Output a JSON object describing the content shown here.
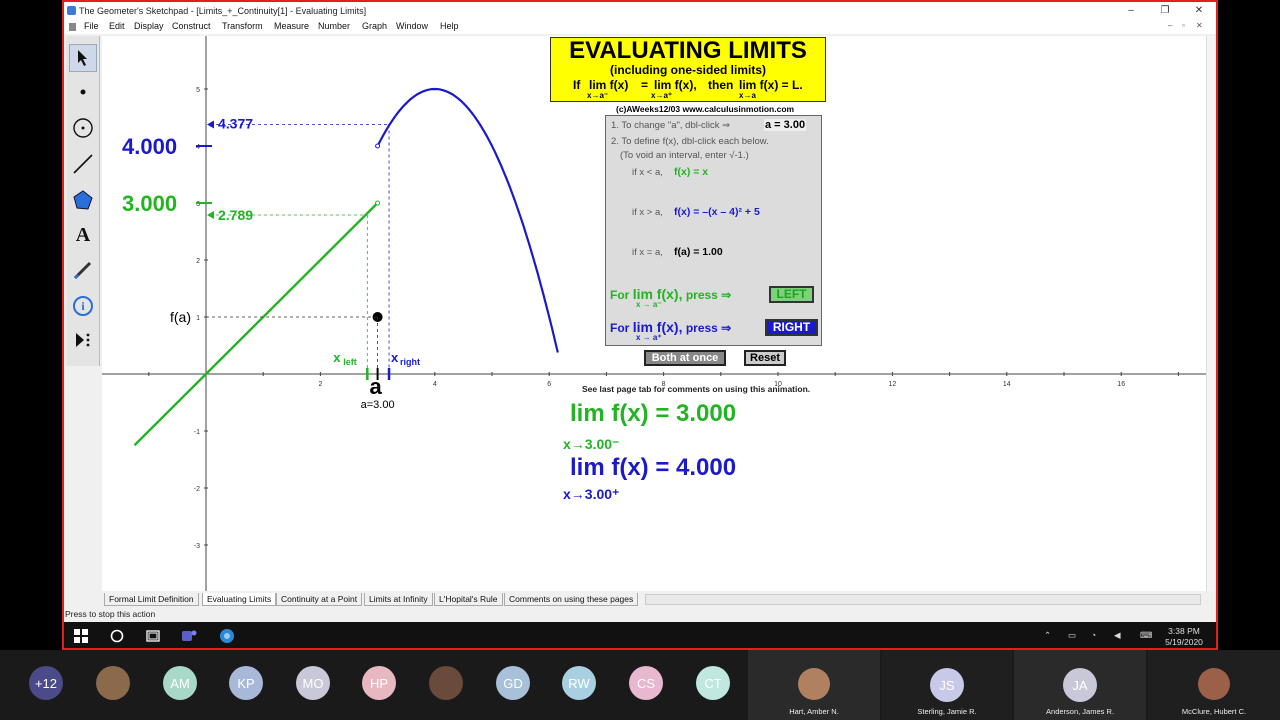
{
  "window": {
    "title": "The Geometer's Sketchpad - [Limits_+_Continuity[1] - Evaluating Limits]",
    "minimize": "–",
    "restore": "❐",
    "close": "✕"
  },
  "menu": [
    "File",
    "Edit",
    "Display",
    "Construct",
    "Transform",
    "Measure",
    "Number",
    "Graph",
    "Window",
    "Help"
  ],
  "tools": [
    "arrow-tool",
    "point-tool",
    "compass-tool",
    "line-tool",
    "polygon-tool",
    "text-tool",
    "marker-tool",
    "information-tool",
    "custom-tool"
  ],
  "text_tool_glyph": "A",
  "info_tool_glyph": "i",
  "banner": {
    "title": "EVALUATING LIMITS",
    "subtitle": "(including one-sided limits)",
    "rule_if": "If",
    "rule_lim1": "lim f(x)",
    "rule_eq1": "=",
    "rule_lim2": "lim f(x),",
    "rule_then": "then",
    "rule_lim3": "lim f(x) = L.",
    "sub1": "x→a⁻",
    "sub2": "x→a⁺",
    "sub3": "x→a",
    "credit": "(c)AWeeks12/03   www.calculusinmotion.com"
  },
  "panel": {
    "step1": "1. To change \"a\", dbl-click ⇒",
    "a_value": "a = 3.00",
    "step2": "2. To define f(x), dbl-click each below.",
    "step2b": "(To void an interval, enter √-1.)",
    "cond_less": "if x < a,",
    "f_less": "f(x) = x",
    "cond_greater": "if x > a,",
    "f_greater": "f(x) = –(x – 4)² + 5",
    "cond_equal": "if x = a,",
    "f_equal": "f(a) = 1.00",
    "for": "For",
    "lim": "lim f(x),",
    "press": "press ⇒",
    "sub_left": "x → a⁻",
    "sub_right": "x → a⁺",
    "left_button": "LEFT",
    "right_button": "RIGHT"
  },
  "buttons": {
    "both": "Both at once",
    "reset": "Reset"
  },
  "note": "See last page tab for comments on using this animation.",
  "results": {
    "left_lim": "lim  f(x) = 3.000",
    "left_sub": "x→3.00⁻",
    "right_lim": "lim  f(x) = 4.000",
    "right_sub": "x→3.00⁺"
  },
  "graph": {
    "x_ticks": [
      "2",
      "4",
      "6",
      "8",
      "10",
      "12",
      "14",
      "16"
    ],
    "y_ticks": [
      "5",
      "4",
      "3",
      "2",
      "1",
      "-1",
      "-2",
      "-3"
    ],
    "label_4000": "4.000",
    "label_3000": "3.000",
    "label_4377": "4.377",
    "label_2789": "2.789",
    "label_fa": "f(a)",
    "label_xleft": "x",
    "label_xleft_sub": "left",
    "label_xright": "x",
    "label_xright_sub": "right",
    "label_a": "a",
    "label_a_value": "a=3.00",
    "colors": {
      "green": "#22b422",
      "blue": "#1a1acc"
    }
  },
  "tabs": [
    "Formal Limit Definition",
    "Evaluating Limits",
    "Continuity at a Point",
    "Limits at Infinity",
    "L'Hopital's Rule",
    "Comments on using these pages"
  ],
  "status": "Press to stop this action",
  "tray": {
    "time": "3:38 PM",
    "date": "5/19/2020"
  },
  "participants": [
    {
      "initials": "+12",
      "color": "#4b4b8a"
    },
    {
      "initials": "",
      "color": "#8a6a4a"
    },
    {
      "initials": "AM",
      "color": "#a8d8c8"
    },
    {
      "initials": "KP",
      "color": "#a8b8d8"
    },
    {
      "initials": "MO",
      "color": "#c8c8d8"
    },
    {
      "initials": "HP",
      "color": "#e8b8c0"
    },
    {
      "initials": "",
      "color": "#6a4a3a"
    },
    {
      "initials": "GD",
      "color": "#a8c0d8"
    },
    {
      "initials": "RW",
      "color": "#a8d0e0"
    },
    {
      "initials": "CS",
      "color": "#e8b8d0"
    },
    {
      "initials": "CT",
      "color": "#c0e8e0"
    }
  ],
  "tiles": [
    {
      "name": "Hart, Amber N.",
      "initials": ""
    },
    {
      "name": "Sterling, Jamie R.",
      "initials": "JS"
    },
    {
      "name": "Anderson, James R.",
      "initials": "JA"
    },
    {
      "name": "McClure, Hubert C.",
      "initials": ""
    }
  ]
}
